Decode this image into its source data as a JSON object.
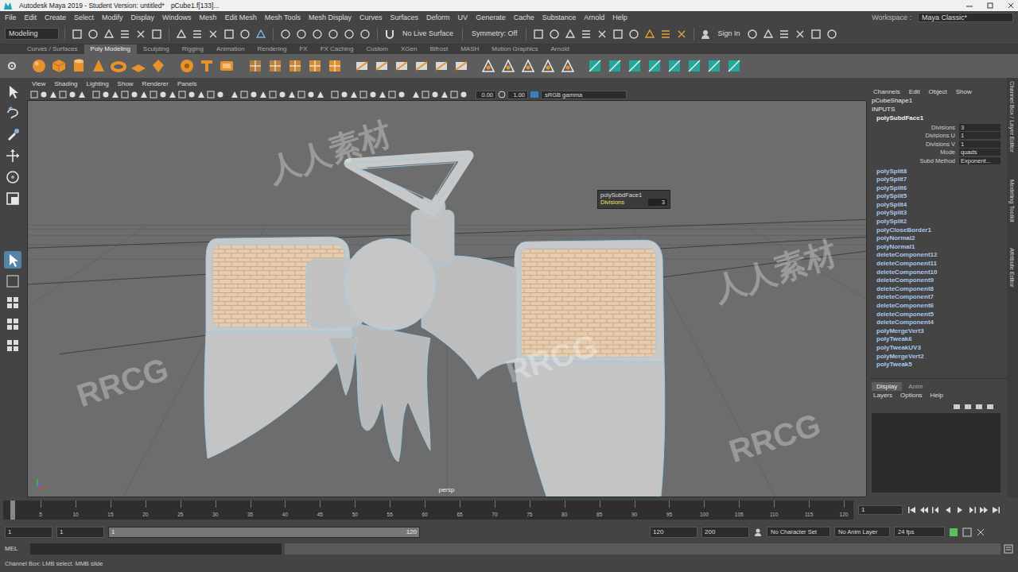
{
  "window": {
    "title": "Autodesk Maya 2019 - Student Version: untitled*",
    "selection": "pCube1.f[133]..."
  },
  "menu": [
    "File",
    "Edit",
    "Create",
    "Select",
    "Modify",
    "Display",
    "Windows",
    "Mesh",
    "Edit Mesh",
    "Mesh Tools",
    "Mesh Display",
    "Curves",
    "Surfaces",
    "Deform",
    "UV",
    "Generate",
    "Cache",
    "Substance",
    "Arnold",
    "Help"
  ],
  "workspace": {
    "label": "Workspace :",
    "value": "Maya Classic*"
  },
  "status_line": {
    "mode": "Modeling",
    "live_surface": "No Live Surface",
    "symmetry": "Symmetry: Off",
    "sign_in": "Sign In"
  },
  "shelf_tabs": [
    {
      "label": "Curves / Surfaces",
      "selected": false
    },
    {
      "label": "Poly Modeling",
      "selected": true
    },
    {
      "label": "Sculpting",
      "selected": false
    },
    {
      "label": "Rigging",
      "selected": false
    },
    {
      "label": "Animation",
      "selected": false
    },
    {
      "label": "Rendering",
      "selected": false
    },
    {
      "label": "FX",
      "selected": false
    },
    {
      "label": "FX Caching",
      "selected": false
    },
    {
      "label": "Custom",
      "selected": false
    },
    {
      "label": "XGen",
      "selected": false
    },
    {
      "label": "Bifrost",
      "selected": false
    },
    {
      "label": "MASH",
      "selected": false
    },
    {
      "label": "Motion Graphics",
      "selected": false
    },
    {
      "label": "Arnold",
      "selected": false
    }
  ],
  "toolbox": [
    {
      "selected": false
    },
    {
      "selected": false
    },
    {
      "selected": false
    },
    {
      "selected": false
    },
    {
      "selected": false
    },
    {
      "selected": false
    },
    {
      "selected": true
    }
  ],
  "panel_menu": [
    "View",
    "Shading",
    "Lighting",
    "Show",
    "Renderer",
    "Panels"
  ],
  "panel_toolbar": {
    "exposure": "0.00",
    "gamma": "1.00",
    "color_space": "sRGB gamma"
  },
  "viewport": {
    "camera": "persp",
    "overlay": {
      "title": "polySubdFace1",
      "label": "Divisions",
      "value": "3"
    }
  },
  "watermarks": [
    "RRCG",
    "人人素材",
    "RRCG",
    "人人素材",
    "RRCG"
  ],
  "channel_box": {
    "tabs": [
      "Channels",
      "Edit",
      "Object",
      "Show"
    ],
    "shape": "pCubeShape1",
    "inputs": "INPUTS",
    "node": "polySubdFace1",
    "attributes": [
      {
        "label": "Divisions",
        "value": "3"
      },
      {
        "label": "Divisions U",
        "value": "1"
      },
      {
        "label": "Divisions V",
        "value": "1"
      },
      {
        "label": "Mode",
        "value": "quads"
      },
      {
        "label": "Subd Method",
        "value": "Exponent..."
      }
    ],
    "history": [
      "polySplit8",
      "polySplit7",
      "polySplit6",
      "polySplit5",
      "polySplit4",
      "polySplit3",
      "polySplit2",
      "polyCloseBorder1",
      "polyNormal2",
      "polyNormal1",
      "deleteComponent12",
      "deleteComponent11",
      "deleteComponent10",
      "deleteComponent9",
      "deleteComponent8",
      "deleteComponent7",
      "deleteComponent6",
      "deleteComponent5",
      "deleteComponent4",
      "polyMergeVert3",
      "polyTweak6",
      "polyTweakUV3",
      "polyMergeVert2",
      "polyTweak5"
    ]
  },
  "layer_editor": {
    "tabs": [
      {
        "label": "Display",
        "selected": true
      },
      {
        "label": "Anim",
        "selected": false
      }
    ],
    "menu": [
      "Layers",
      "Options",
      "Help"
    ]
  },
  "side_tabs": [
    "Channel Box / Layer Editor",
    "Modeling Toolkit",
    "Attribute Editor"
  ],
  "time_slider": {
    "ticks": [
      "1",
      "5",
      "10",
      "15",
      "20",
      "25",
      "30",
      "35",
      "40",
      "45",
      "50",
      "55",
      "60",
      "65",
      "70",
      "75",
      "80",
      "85",
      "90",
      "95",
      "100",
      "105",
      "110",
      "115",
      "120"
    ],
    "current_frame": "1"
  },
  "range_slider": {
    "start": "1",
    "inner_start": "1",
    "slider_start": "1",
    "slider_end": "120",
    "inner_end": "120",
    "end": "200",
    "character_set": "No Character Set",
    "anim_layer": "No Anim Layer",
    "fps": "24 fps"
  },
  "command_line": {
    "language": "MEL"
  },
  "help_line": "Channel Box: LMB select. MMB slide"
}
